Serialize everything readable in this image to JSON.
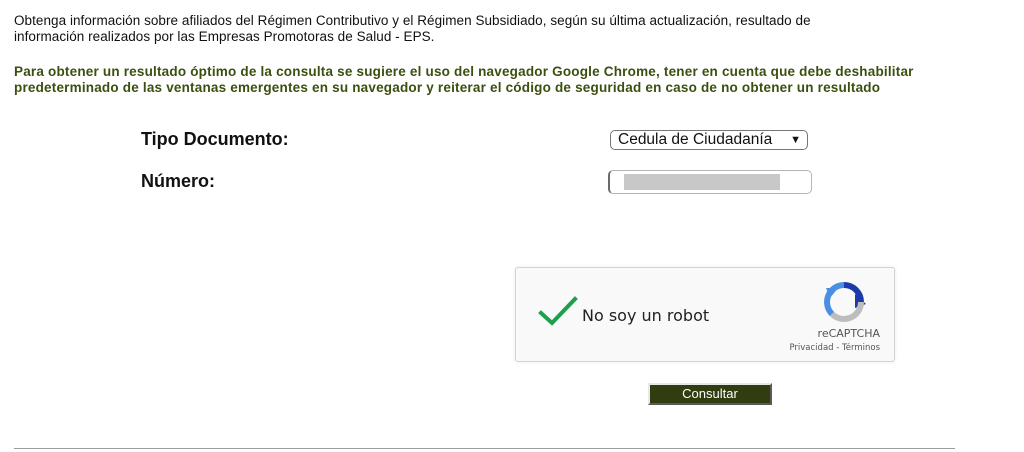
{
  "intro": {
    "line1": "Obtenga información sobre afiliados del Régimen Contributivo y el Régimen Subsidiado, según su última actualización, resultado de",
    "line2": "información realizados por las Empresas Promotoras de Salud - EPS."
  },
  "notice": {
    "line1": "Para obtener un resultado óptimo de la consulta se sugiere el uso del navegador Google Chrome, tener en cuenta que debe deshabilitar",
    "line2": "predeterminado de las ventanas emergentes en su navegador y reiterar el código de seguridad en caso de no obtener un resultado"
  },
  "form": {
    "tipo_label": "Tipo Documento:",
    "tipo_value": "Cedula de Ciudadanía",
    "dropdown_arrow": "▼",
    "numero_label": "Número:",
    "numero_value": ""
  },
  "captcha": {
    "label": "No soy un robot",
    "brand": "reCAPTCHA",
    "links": "Privacidad - Términos",
    "check_color": "#1e9e4f",
    "logo_icon": "recaptcha-logo-icon"
  },
  "submit_label": "Consultar",
  "colors": {
    "notice_text": "#3b4f10",
    "button_bg": "#2f3d0f"
  }
}
